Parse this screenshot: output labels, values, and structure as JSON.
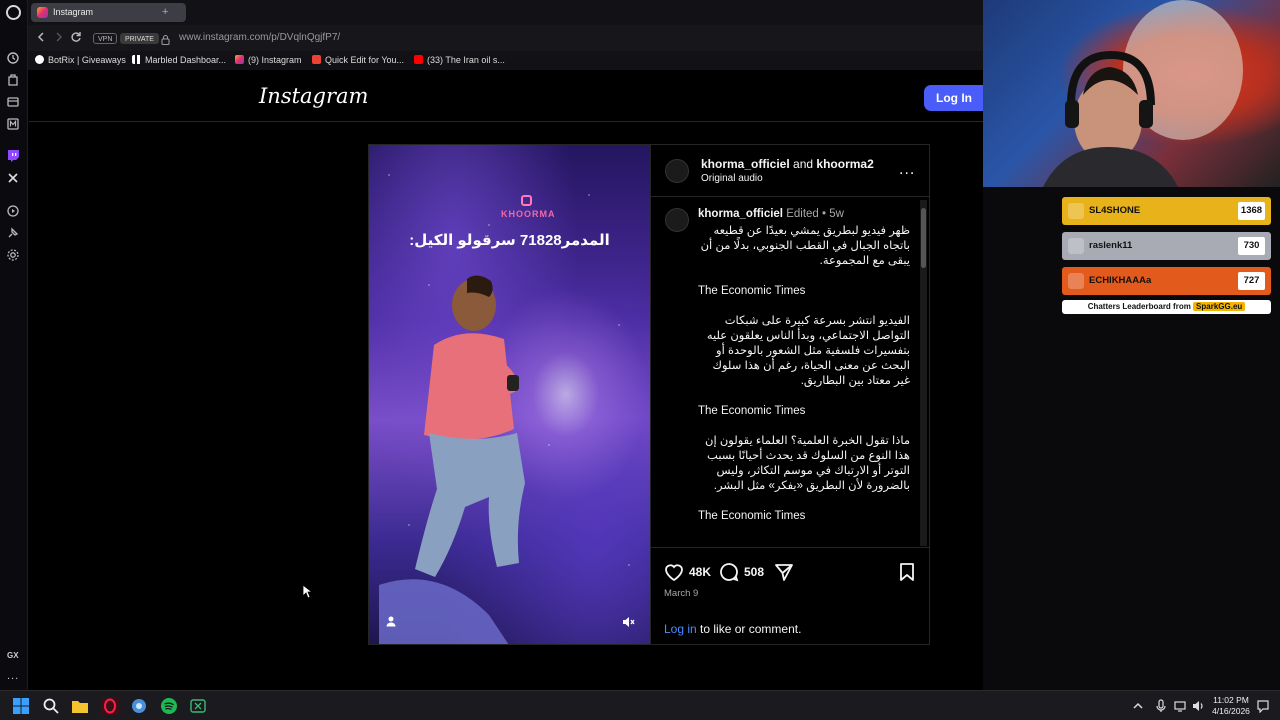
{
  "browser": {
    "tab_title": "Instagram",
    "tab_add": "+",
    "vpn_label": "VPN",
    "private_label": "PRIVATE",
    "url": "www.instagram.com/p/DVqlnQgjfP7/",
    "bookmarks": [
      {
        "label": "BotRix | Giveaways",
        "icon": "botrix-icon",
        "color": "#ffffff"
      },
      {
        "label": "Marbled Dashboar...",
        "icon": "grid-icon",
        "color": "#ffffff"
      },
      {
        "label": "(9) Instagram",
        "icon": "instagram-icon",
        "color": "#e1306c"
      },
      {
        "label": "Quick Edit for You...",
        "icon": "gmail-icon",
        "color": "#ea4335"
      },
      {
        "label": "(33) The Iran oil s...",
        "icon": "youtube-icon",
        "color": "#ff0000"
      }
    ]
  },
  "sidebar": {
    "gx_label": "GX",
    "more_label": "..."
  },
  "instagram": {
    "logo_text": "Instagram",
    "login_label": "Log In"
  },
  "post": {
    "author": "khorma_officiel",
    "and_text": "and",
    "coauthor": "khoorma2",
    "audio": "Original audio",
    "more": "...",
    "video_brand": "KHOORMA",
    "video_caption": "المدمر71828 سرقولو الكيل:",
    "comment": {
      "username": "khorma_officiel",
      "meta": " Edited • 5w",
      "paragraphs": [
        {
          "text": "ظهر فيديو لبطريق يمشي بعيدًا عن قطيعه باتجاه الجبال في القطب الجنوبي، بدلًا من أن يبقى مع المجموعة.",
          "rtl": true
        },
        {
          "text": "The Economic Times",
          "rtl": false
        },
        {
          "text": "الفيديو انتشر بسرعة كبيرة على شبكات التواصل الاجتماعي، وبدأ الناس يعلقون عليه بتفسيرات فلسفية مثل الشعور بالوحدة أو البحث عن معنى الحياة، رغم أن هذا سلوك غير معتاد بين البطاريق.",
          "rtl": true
        },
        {
          "text": "The Economic Times",
          "rtl": false
        },
        {
          "text": "ماذا تقول الخبرة العلمية؟ العلماء يقولون إن هذا النوع من السلوك قد يحدث أحيانًا بسبب التوتر أو الارتباك في موسم التكاثر، وليس بالضرورة لأن البطريق «يفكر» مثل البشر.",
          "rtl": true
        },
        {
          "text": "The Economic Times",
          "rtl": false
        }
      ]
    },
    "likes": "48K",
    "comments_count": "508",
    "date": "March 9",
    "login_link": "Log in",
    "login_suffix": " to like or comment."
  },
  "leaderboard": {
    "rows": [
      {
        "name": "SL4SHONE",
        "score": "1368",
        "color": "#e8b21a",
        "text_color": "#111111"
      },
      {
        "name": "raslenk11",
        "score": "730",
        "color": "#a8aab4",
        "text_color": "#111111"
      },
      {
        "name": "ECHIKHAAAa",
        "score": "727",
        "color": "#e25a1c",
        "text_color": "#111111"
      }
    ],
    "footer_text": "Chatters Leaderboard from ",
    "footer_brand": "SparkGG.eu"
  },
  "taskbar": {
    "time": "11:02 PM",
    "date": "4/16/2026",
    "apps": [
      "windows-start-icon",
      "search-icon",
      "file-explorer-icon",
      "opera-gx-icon",
      "app-icon",
      "spotify-icon",
      "xbox-icon"
    ]
  },
  "colors": {
    "accent": "#4a5df9",
    "link": "#4a8cff",
    "background": "#000000"
  }
}
